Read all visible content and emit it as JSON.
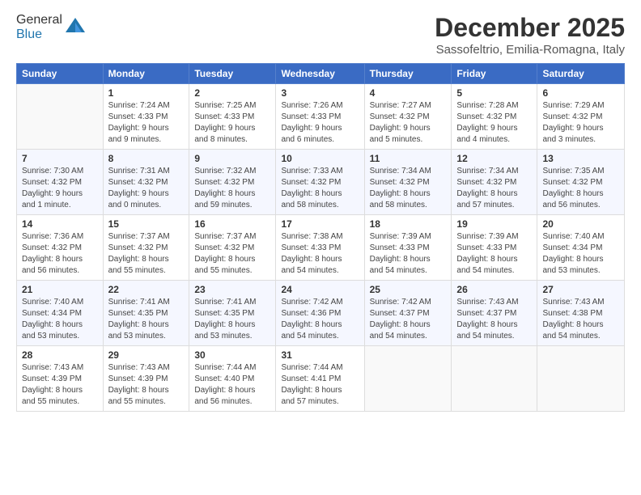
{
  "header": {
    "logo_general": "General",
    "logo_blue": "Blue",
    "month_year": "December 2025",
    "location": "Sassofeltrio, Emilia-Romagna, Italy"
  },
  "weekdays": [
    "Sunday",
    "Monday",
    "Tuesday",
    "Wednesday",
    "Thursday",
    "Friday",
    "Saturday"
  ],
  "weeks": [
    [
      {
        "day": "",
        "info": ""
      },
      {
        "day": "1",
        "info": "Sunrise: 7:24 AM\nSunset: 4:33 PM\nDaylight: 9 hours\nand 9 minutes."
      },
      {
        "day": "2",
        "info": "Sunrise: 7:25 AM\nSunset: 4:33 PM\nDaylight: 9 hours\nand 8 minutes."
      },
      {
        "day": "3",
        "info": "Sunrise: 7:26 AM\nSunset: 4:33 PM\nDaylight: 9 hours\nand 6 minutes."
      },
      {
        "day": "4",
        "info": "Sunrise: 7:27 AM\nSunset: 4:32 PM\nDaylight: 9 hours\nand 5 minutes."
      },
      {
        "day": "5",
        "info": "Sunrise: 7:28 AM\nSunset: 4:32 PM\nDaylight: 9 hours\nand 4 minutes."
      },
      {
        "day": "6",
        "info": "Sunrise: 7:29 AM\nSunset: 4:32 PM\nDaylight: 9 hours\nand 3 minutes."
      }
    ],
    [
      {
        "day": "7",
        "info": "Sunrise: 7:30 AM\nSunset: 4:32 PM\nDaylight: 9 hours\nand 1 minute."
      },
      {
        "day": "8",
        "info": "Sunrise: 7:31 AM\nSunset: 4:32 PM\nDaylight: 9 hours\nand 0 minutes."
      },
      {
        "day": "9",
        "info": "Sunrise: 7:32 AM\nSunset: 4:32 PM\nDaylight: 8 hours\nand 59 minutes."
      },
      {
        "day": "10",
        "info": "Sunrise: 7:33 AM\nSunset: 4:32 PM\nDaylight: 8 hours\nand 58 minutes."
      },
      {
        "day": "11",
        "info": "Sunrise: 7:34 AM\nSunset: 4:32 PM\nDaylight: 8 hours\nand 58 minutes."
      },
      {
        "day": "12",
        "info": "Sunrise: 7:34 AM\nSunset: 4:32 PM\nDaylight: 8 hours\nand 57 minutes."
      },
      {
        "day": "13",
        "info": "Sunrise: 7:35 AM\nSunset: 4:32 PM\nDaylight: 8 hours\nand 56 minutes."
      }
    ],
    [
      {
        "day": "14",
        "info": "Sunrise: 7:36 AM\nSunset: 4:32 PM\nDaylight: 8 hours\nand 56 minutes."
      },
      {
        "day": "15",
        "info": "Sunrise: 7:37 AM\nSunset: 4:32 PM\nDaylight: 8 hours\nand 55 minutes."
      },
      {
        "day": "16",
        "info": "Sunrise: 7:37 AM\nSunset: 4:32 PM\nDaylight: 8 hours\nand 55 minutes."
      },
      {
        "day": "17",
        "info": "Sunrise: 7:38 AM\nSunset: 4:33 PM\nDaylight: 8 hours\nand 54 minutes."
      },
      {
        "day": "18",
        "info": "Sunrise: 7:39 AM\nSunset: 4:33 PM\nDaylight: 8 hours\nand 54 minutes."
      },
      {
        "day": "19",
        "info": "Sunrise: 7:39 AM\nSunset: 4:33 PM\nDaylight: 8 hours\nand 54 minutes."
      },
      {
        "day": "20",
        "info": "Sunrise: 7:40 AM\nSunset: 4:34 PM\nDaylight: 8 hours\nand 53 minutes."
      }
    ],
    [
      {
        "day": "21",
        "info": "Sunrise: 7:40 AM\nSunset: 4:34 PM\nDaylight: 8 hours\nand 53 minutes."
      },
      {
        "day": "22",
        "info": "Sunrise: 7:41 AM\nSunset: 4:35 PM\nDaylight: 8 hours\nand 53 minutes."
      },
      {
        "day": "23",
        "info": "Sunrise: 7:41 AM\nSunset: 4:35 PM\nDaylight: 8 hours\nand 53 minutes."
      },
      {
        "day": "24",
        "info": "Sunrise: 7:42 AM\nSunset: 4:36 PM\nDaylight: 8 hours\nand 54 minutes."
      },
      {
        "day": "25",
        "info": "Sunrise: 7:42 AM\nSunset: 4:37 PM\nDaylight: 8 hours\nand 54 minutes."
      },
      {
        "day": "26",
        "info": "Sunrise: 7:43 AM\nSunset: 4:37 PM\nDaylight: 8 hours\nand 54 minutes."
      },
      {
        "day": "27",
        "info": "Sunrise: 7:43 AM\nSunset: 4:38 PM\nDaylight: 8 hours\nand 54 minutes."
      }
    ],
    [
      {
        "day": "28",
        "info": "Sunrise: 7:43 AM\nSunset: 4:39 PM\nDaylight: 8 hours\nand 55 minutes."
      },
      {
        "day": "29",
        "info": "Sunrise: 7:43 AM\nSunset: 4:39 PM\nDaylight: 8 hours\nand 55 minutes."
      },
      {
        "day": "30",
        "info": "Sunrise: 7:44 AM\nSunset: 4:40 PM\nDaylight: 8 hours\nand 56 minutes."
      },
      {
        "day": "31",
        "info": "Sunrise: 7:44 AM\nSunset: 4:41 PM\nDaylight: 8 hours\nand 57 minutes."
      },
      {
        "day": "",
        "info": ""
      },
      {
        "day": "",
        "info": ""
      },
      {
        "day": "",
        "info": ""
      }
    ]
  ]
}
